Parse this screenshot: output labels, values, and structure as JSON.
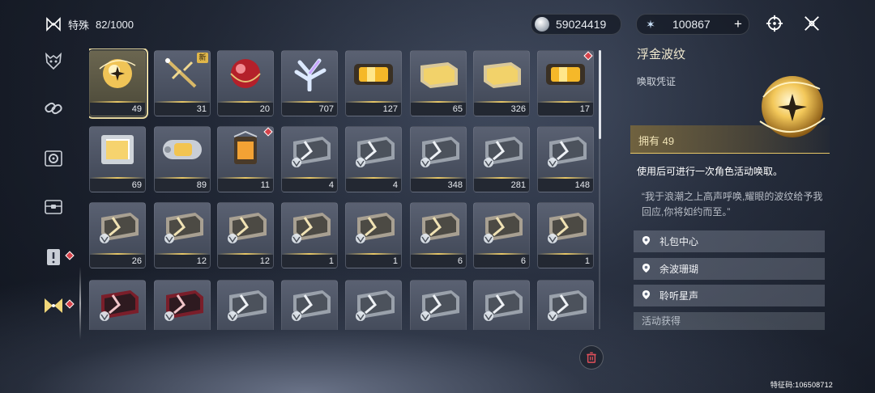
{
  "header": {
    "category_label": "特殊",
    "capacity": "82/1000",
    "currency1": "59024419",
    "currency2": "100867"
  },
  "sidebar": {
    "items": [
      {
        "name": "demon-mask-icon"
      },
      {
        "name": "chain-link-icon"
      },
      {
        "name": "gear-box-icon"
      },
      {
        "name": "chest-icon"
      },
      {
        "name": "exclamation-doc-icon"
      },
      {
        "name": "special-bowtie-icon"
      }
    ]
  },
  "grid": {
    "items": [
      {
        "count": "49",
        "kind": "orb-gold",
        "selected": true
      },
      {
        "count": "31",
        "kind": "sword",
        "badge": "新"
      },
      {
        "count": "20",
        "kind": "orb-red"
      },
      {
        "count": "707",
        "kind": "coral"
      },
      {
        "count": "127",
        "kind": "canister-gold"
      },
      {
        "count": "65",
        "kind": "box-gold"
      },
      {
        "count": "326",
        "kind": "box-gold"
      },
      {
        "count": "17",
        "kind": "canister-gold",
        "dot": true
      },
      {
        "count": "69",
        "kind": "box-silver"
      },
      {
        "count": "89",
        "kind": "canister-silver"
      },
      {
        "count": "11",
        "kind": "lantern",
        "dot": true
      },
      {
        "count": "4",
        "kind": "crate-silver"
      },
      {
        "count": "4",
        "kind": "crate-silver"
      },
      {
        "count": "348",
        "kind": "crate-silver"
      },
      {
        "count": "281",
        "kind": "crate-silver"
      },
      {
        "count": "148",
        "kind": "crate-silver"
      },
      {
        "count": "26",
        "kind": "crate-gold"
      },
      {
        "count": "12",
        "kind": "crate-gold"
      },
      {
        "count": "12",
        "kind": "crate-gold"
      },
      {
        "count": "1",
        "kind": "crate-gold"
      },
      {
        "count": "1",
        "kind": "crate-gold"
      },
      {
        "count": "6",
        "kind": "crate-gold"
      },
      {
        "count": "6",
        "kind": "crate-gold"
      },
      {
        "count": "1",
        "kind": "crate-gold"
      },
      {
        "count": "",
        "kind": "crate-red"
      },
      {
        "count": "",
        "kind": "crate-red"
      },
      {
        "count": "",
        "kind": "crate-silver"
      },
      {
        "count": "",
        "kind": "crate-silver"
      },
      {
        "count": "",
        "kind": "crate-silver"
      },
      {
        "count": "",
        "kind": "crate-silver"
      },
      {
        "count": "",
        "kind": "crate-silver"
      },
      {
        "count": "",
        "kind": "crate-silver"
      }
    ]
  },
  "detail": {
    "title": "浮金波纹",
    "subtitle": "唤取凭证",
    "owned": "拥有 49",
    "description": "使用后可进行一次角色活动唤取。",
    "quote": "“我于浪潮之上高声呼唤,耀眼的波纹给予我回应,你将如约而至。”",
    "sources": [
      "礼包中心",
      "余波珊瑚",
      "聆听星声"
    ],
    "obtain_label": "活动获得"
  },
  "footer": {
    "uid": "特征码:106508712"
  },
  "colors": {
    "accent_gold": "#e8c766",
    "alert_red": "#d6424a"
  }
}
